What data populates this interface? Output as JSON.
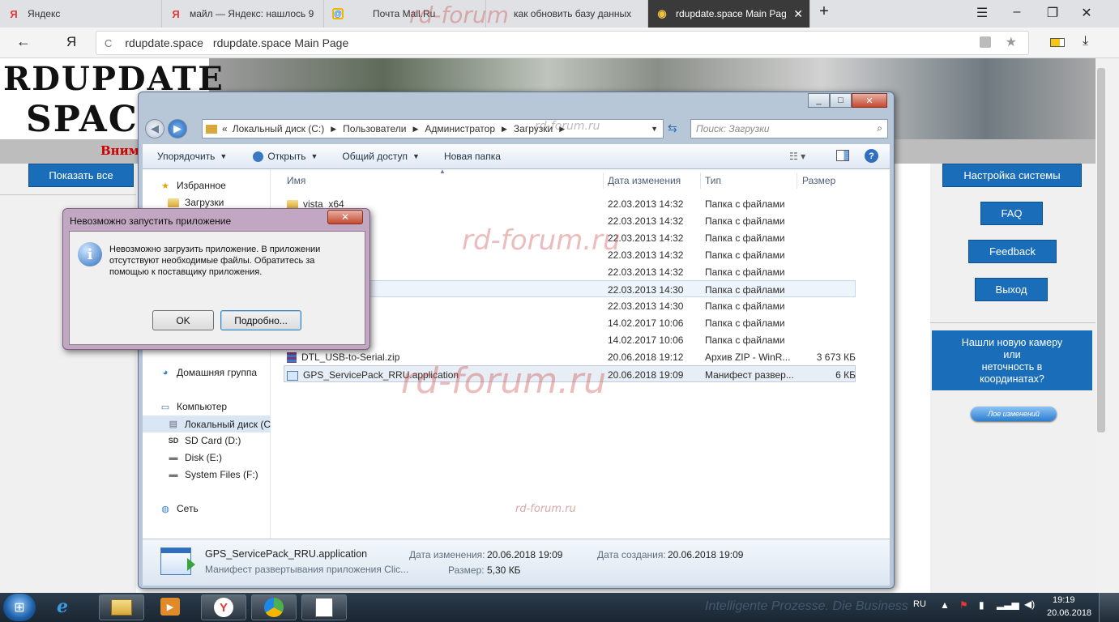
{
  "browser": {
    "tabs": [
      {
        "label": "Яндекс",
        "icon": "Я",
        "icon_color": "#e53935"
      },
      {
        "label": "майл — Яндекс: нашлось 9",
        "icon": "Я",
        "icon_color": "#e53935"
      },
      {
        "label": "Почта Mail.Ru",
        "icon": "@",
        "icon_color": "#168de2"
      },
      {
        "label": "как обновить базу данных",
        "icon": "",
        "icon_color": "#999999"
      },
      {
        "label": "rdupdate.space Main Pag",
        "icon": "◉",
        "icon_color": "#f0c040"
      }
    ],
    "new_tab": "+",
    "back": "←",
    "yandex_logo": "Я",
    "reload": "C",
    "domain": "rdupdate.space",
    "page_title": "rdupdate.space Main Page"
  },
  "site": {
    "logo_line1": "RDUPDATE",
    "logo_line2": "SPAC",
    "warning_fragment": "Вним",
    "left_button": "Показать все",
    "right_buttons": [
      "Настройка системы",
      "FAQ",
      "Feedback",
      "Выход"
    ],
    "camera_box_lines": [
      "Нашли новую камеру",
      "или",
      "неточность в",
      "координатах?"
    ],
    "changes_button": "Лое изменений"
  },
  "explorer": {
    "path": [
      "«",
      "Локальный диск (C:)",
      "Пользователи",
      "Администратор",
      "Загрузки"
    ],
    "search_placeholder": "Поиск: Загрузки",
    "toolbar": {
      "organize": "Упорядочить",
      "open": "Открыть",
      "share": "Общий доступ",
      "new_folder": "Новая папка"
    },
    "nav": {
      "favorites": "Избранное",
      "downloads": "Загрузки",
      "homegroup": "Домашняя группа",
      "computer": "Компьютер",
      "local_disk": "Локальный диск (C",
      "sd_card": "SD Card (D:)",
      "disk_e": "Disk (E:)",
      "system_files": "System Files (F:)",
      "network": "Сеть"
    },
    "columns": {
      "name": "Имя",
      "date": "Дата изменения",
      "type": "Тип",
      "size": "Размер"
    },
    "files": [
      {
        "name": "vista_x64",
        "date": "22.03.2013 14:32",
        "type": "Папка с файлами",
        "size": ""
      },
      {
        "name": "",
        "date": "22.03.2013 14:32",
        "type": "Папка с файлами",
        "size": ""
      },
      {
        "name": "",
        "date": "22.03.2013 14:32",
        "type": "Папка с файлами",
        "size": ""
      },
      {
        "name": "",
        "date": "22.03.2013 14:32",
        "type": "Папка с файлами",
        "size": ""
      },
      {
        "name": "",
        "date": "22.03.2013 14:32",
        "type": "Папка с файлами",
        "size": ""
      },
      {
        "name": "",
        "date": "22.03.2013 14:30",
        "type": "Папка с файлами",
        "size": ""
      },
      {
        "name": "",
        "date": "22.03.2013 14:30",
        "type": "Папка с файлами",
        "size": ""
      },
      {
        "name": "",
        "date": "14.02.2017 10:06",
        "type": "Папка с файлами",
        "size": ""
      },
      {
        "name": "",
        "date": "14.02.2017 10:06",
        "type": "Папка с файлами",
        "size": ""
      },
      {
        "name": "DTL_USB-to-Serial.zip",
        "date": "20.06.2018 19:12",
        "type": "Архив ZIP - WinR...",
        "size": "3 673 КБ"
      },
      {
        "name": "GPS_ServicePack_RRU.application",
        "date": "20.06.2018 19:09",
        "type": "Манифест развер...",
        "size": "6 КБ"
      }
    ],
    "details": {
      "filename": "GPS_ServicePack_RRU.application",
      "description": "Манифест развертывания приложения Clic...",
      "modified_label": "Дата изменения:",
      "modified_value": "20.06.2018 19:09",
      "created_label": "Дата создания:",
      "created_value": "20.06.2018 19:09",
      "size_label": "Размер:",
      "size_value": "5,30 КБ"
    }
  },
  "dialog": {
    "title": "Невозможно запустить приложение",
    "message": "Невозможно загрузить приложение. В приложении отсутствуют необходимые файлы. Обратитесь за помощью к поставщику приложения.",
    "ok": "OK",
    "details": "Подробно..."
  },
  "watermarks": [
    "rd-forum",
    "rd-forum.ru",
    "rd-forum.ru",
    "rd-forum.ru",
    "rd-forum.ru",
    "Intelligente Prozesse. Die Business"
  ],
  "taskbar": {
    "lang": "RU",
    "time": "19:19",
    "date": "20.06.2018"
  },
  "colors": {
    "site_blue": "#1a6eb9",
    "warning_red": "#cc0000",
    "tab_active": "#3a3a3a"
  }
}
